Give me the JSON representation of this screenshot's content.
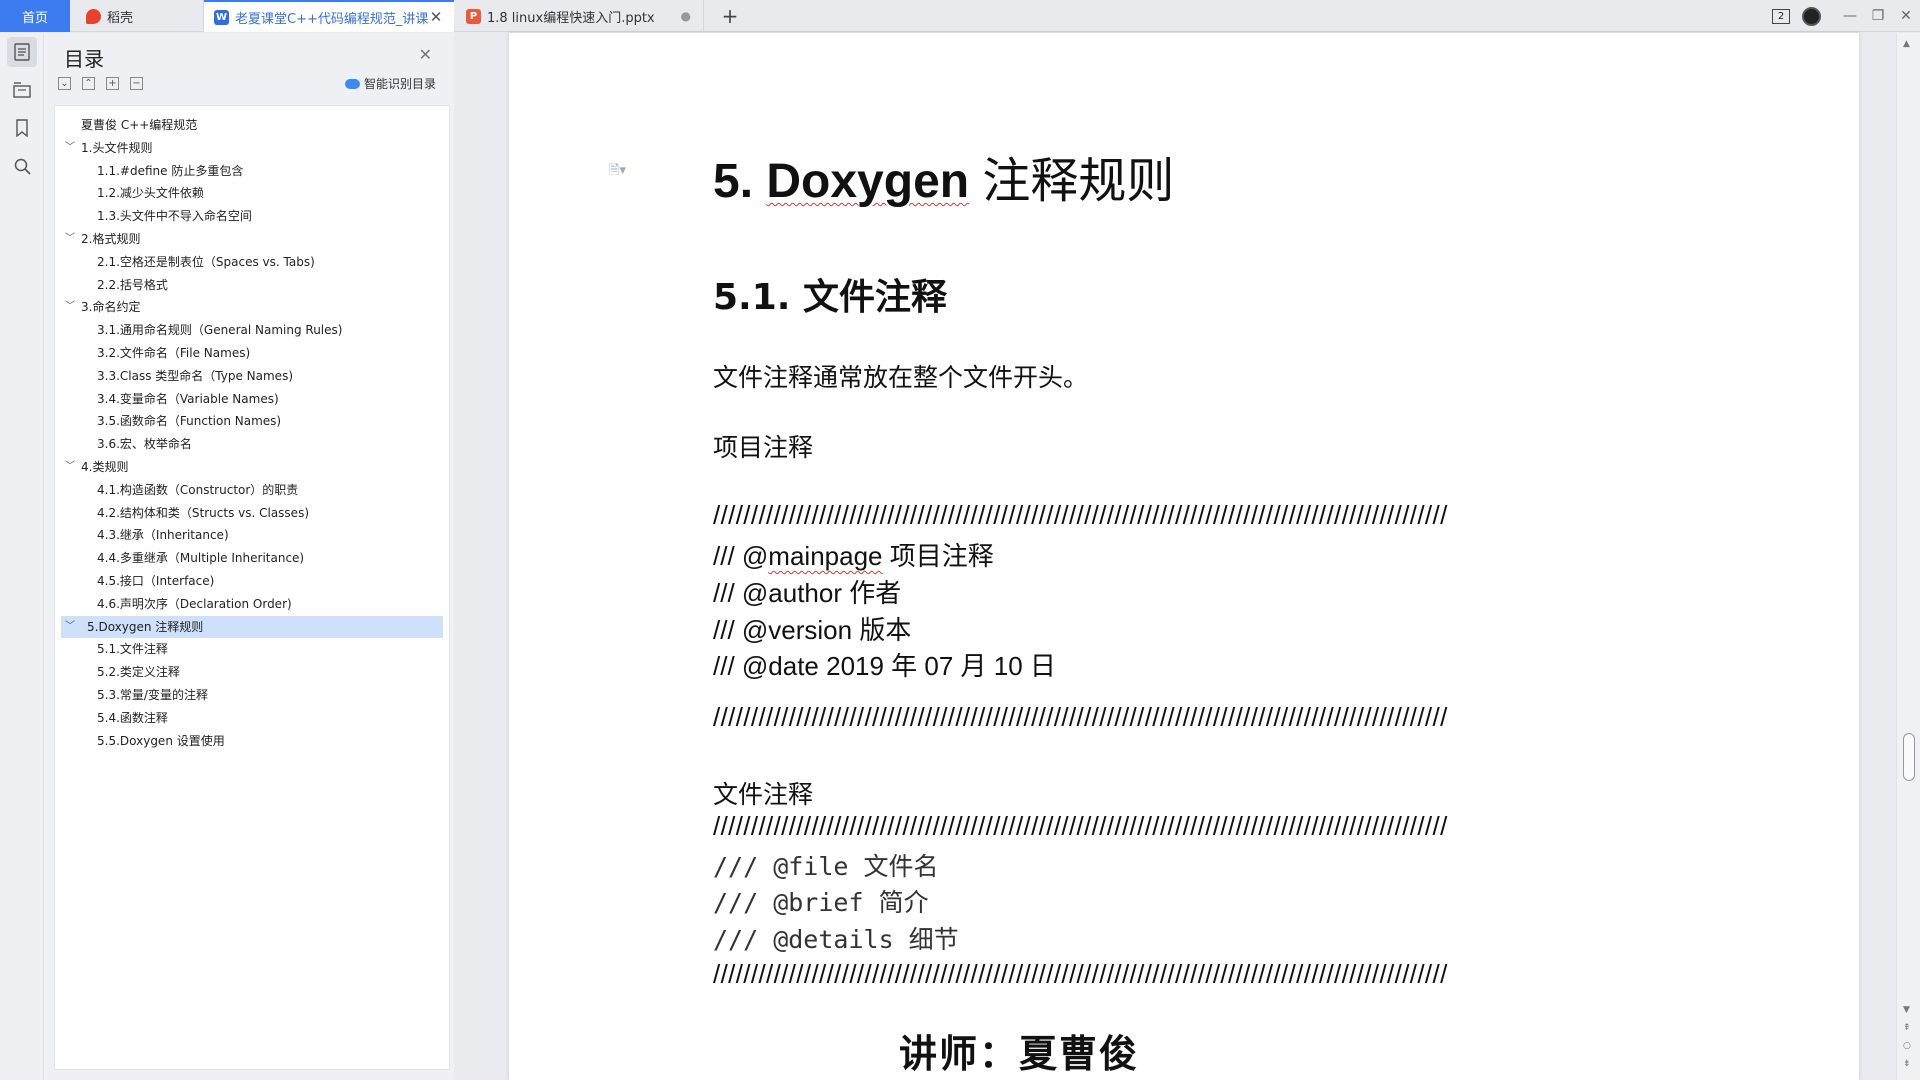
{
  "tabs": {
    "home": "首页",
    "daoke": "稻壳",
    "doc": "老夏课堂C++代码编程规范_讲课",
    "ppt": "1.8 linux编程快速入门.pptx"
  },
  "window": {
    "page_count": "2"
  },
  "outline": {
    "title": "目录",
    "smart_label": "智能识别目录",
    "items": [
      {
        "label": "夏曹俊 C++编程规范",
        "level": 1,
        "chev": ""
      },
      {
        "label": "1.头文件规则",
        "level": 1,
        "chev": "v"
      },
      {
        "label": "1.1.#define 防止多重包含",
        "level": 2,
        "chev": ""
      },
      {
        "label": "1.2.减少头文件依赖",
        "level": 2,
        "chev": ""
      },
      {
        "label": "1.3.头文件中不导入命名空间",
        "level": 2,
        "chev": ""
      },
      {
        "label": "2.格式规则",
        "level": 1,
        "chev": "v"
      },
      {
        "label": "2.1.空格还是制表位（Spaces vs. Tabs)",
        "level": 2,
        "chev": ""
      },
      {
        "label": "2.2.括号格式",
        "level": 2,
        "chev": ""
      },
      {
        "label": "3.命名约定",
        "level": 1,
        "chev": "v"
      },
      {
        "label": "3.1.通用命名规则（General Naming Rules)",
        "level": 2,
        "chev": ""
      },
      {
        "label": "3.2.文件命名（File Names)",
        "level": 2,
        "chev": ""
      },
      {
        "label": "3.3.Class 类型命名（Type Names)",
        "level": 2,
        "chev": ""
      },
      {
        "label": "3.4.变量命名（Variable Names)",
        "level": 2,
        "chev": ""
      },
      {
        "label": "3.5.函数命名（Function Names)",
        "level": 2,
        "chev": ""
      },
      {
        "label": "3.6.宏、枚举命名",
        "level": 2,
        "chev": ""
      },
      {
        "label": "4.类规则",
        "level": 1,
        "chev": "v"
      },
      {
        "label": "4.1.构造函数（Constructor）的职责",
        "level": 2,
        "chev": ""
      },
      {
        "label": "4.2.结构体和类（Structs vs. Classes)",
        "level": 2,
        "chev": ""
      },
      {
        "label": "4.3.继承（Inheritance)",
        "level": 2,
        "chev": ""
      },
      {
        "label": "4.4.多重继承（Multiple Inheritance)",
        "level": 2,
        "chev": ""
      },
      {
        "label": "4.5.接口（Interface)",
        "level": 2,
        "chev": ""
      },
      {
        "label": "4.6.声明次序（Declaration Order)",
        "level": 2,
        "chev": ""
      },
      {
        "label": "5.Doxygen 注释规则",
        "level": 1,
        "chev": "v",
        "selected": true
      },
      {
        "label": "5.1.文件注释",
        "level": 2,
        "chev": ""
      },
      {
        "label": "5.2.类定义注释",
        "level": 2,
        "chev": ""
      },
      {
        "label": "5.3.常量/变量的注释",
        "level": 2,
        "chev": ""
      },
      {
        "label": "5.4.函数注释",
        "level": 2,
        "chev": ""
      },
      {
        "label": "5.5.Doxygen 设置使用",
        "level": 2,
        "chev": ""
      }
    ]
  },
  "doc": {
    "h1_num": "5. ",
    "h1_en": "Doxygen",
    "h1_cn": " 注释规则",
    "h2": "5.1. 文件注释",
    "p1": "文件注释通常放在整个文件开头。",
    "p2": "项目注释",
    "slashes": "/////////////////////////////////////////////////////////////////////////////////////////////////",
    "t1_prefix": "/// @",
    "t1_word": "mainpage",
    "t1_rest": "  项目注释",
    "t2": "/// @author  作者",
    "t3": "/// @version  版本",
    "t4": "/// @date 2019 年 07 月 10 日",
    "p3": "文件注释",
    "m1": "/// @file 文件名",
    "m2": "/// @brief 简介",
    "m3": "/// @details 细节",
    "lecturer": "讲师：夏曹俊"
  }
}
